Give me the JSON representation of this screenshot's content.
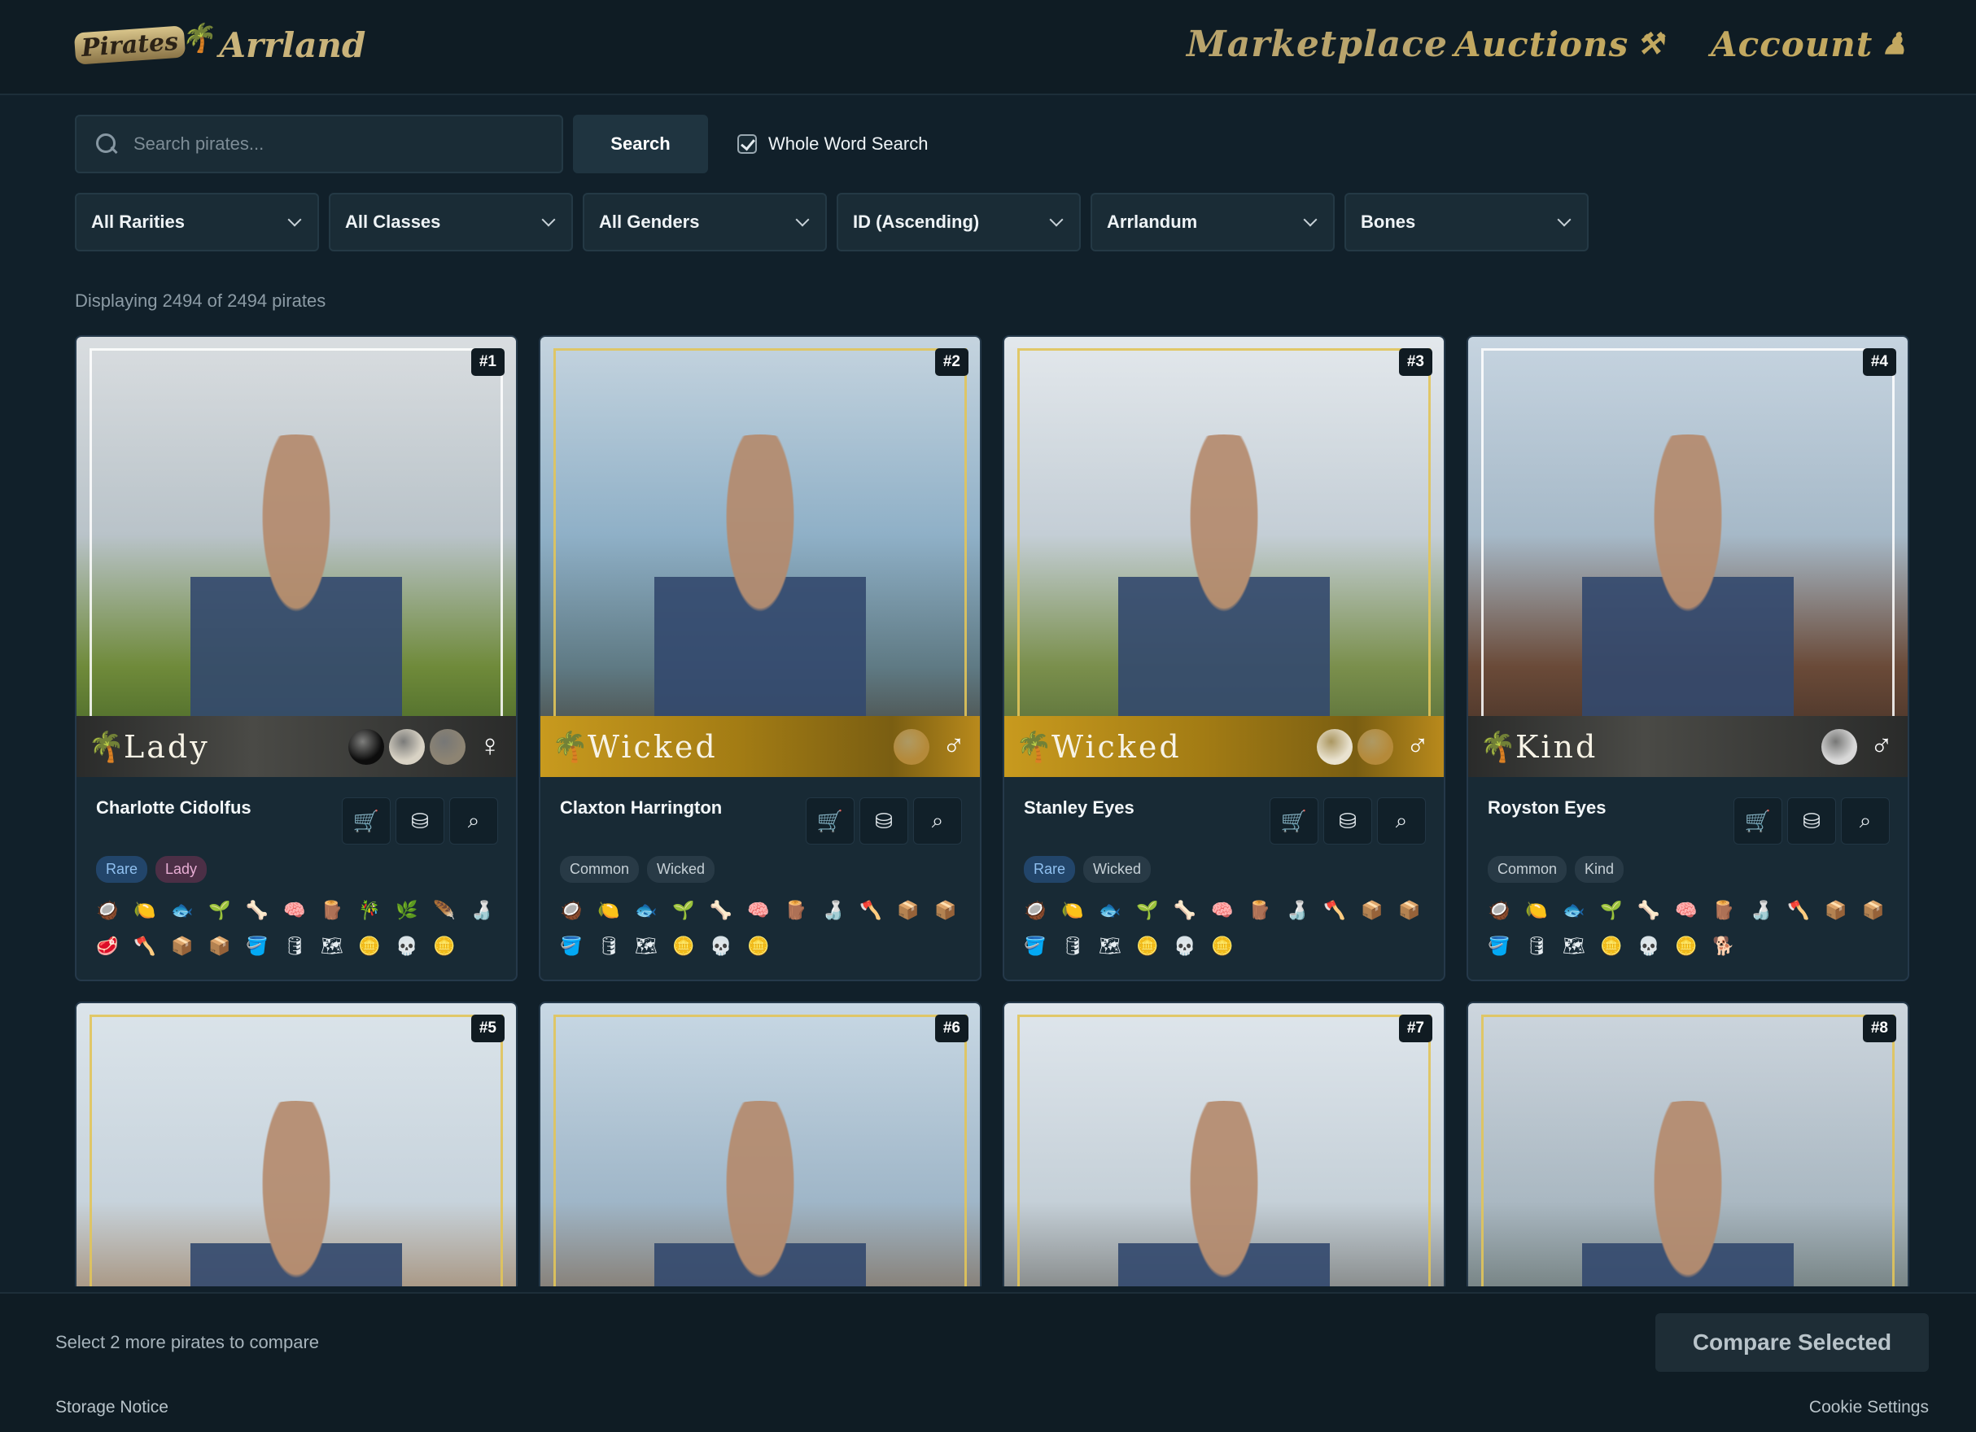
{
  "header": {
    "logo_top": "Pirates",
    "logo_main": "Arrland",
    "nav": [
      {
        "label": "Marketplace"
      },
      {
        "label": "Auctions"
      },
      {
        "label": "Account"
      }
    ]
  },
  "search": {
    "placeholder": "Search pirates...",
    "value": "",
    "button": "Search",
    "whole_word": {
      "label": "Whole Word Search",
      "checked": true
    }
  },
  "filters": [
    "All Rarities",
    "All Classes",
    "All Genders",
    "ID (Ascending)",
    "Arrlandum",
    "Bones"
  ],
  "results_text": "Displaying 2494 of 2494 pirates",
  "cards": [
    {
      "id": "#1",
      "name": "Charlotte Cidolfus",
      "class": "Lady",
      "gender": "♀",
      "strip": "dark",
      "tags": [
        {
          "t": "Rare",
          "k": "rare"
        },
        {
          "t": "Lady",
          "k": "lady"
        }
      ],
      "bg": [
        "#d9dde0",
        "#b9c3c9",
        "#6f8a3a",
        "#3a5a22"
      ],
      "medals": [
        "#0d0d0d",
        "#d8d2c4",
        "#8d8473"
      ],
      "icons": [
        "🥥",
        "🍋",
        "🐟",
        "🌱",
        "🦴",
        "🧠",
        "🪵",
        "🎋",
        "🌿",
        "🪶",
        "🍶",
        "🥩",
        "🪓",
        "📦",
        "📦",
        "🪣",
        "🛢",
        "🗺",
        "🪙",
        "💀",
        "🪙"
      ]
    },
    {
      "id": "#2",
      "name": "Claxton Harrington",
      "class": "Wicked",
      "gender": "♂",
      "strip": "gold",
      "tags": [
        {
          "t": "Common",
          "k": ""
        },
        {
          "t": "Wicked",
          "k": ""
        }
      ],
      "bg": [
        "#c5d4df",
        "#8fb0c7",
        "#5f7a84",
        "#403628"
      ],
      "medals": [
        "#b58a3a"
      ],
      "icons": [
        "🥥",
        "🍋",
        "🐟",
        "🌱",
        "🦴",
        "🧠",
        "🪵",
        "🍶",
        "🪓",
        "📦",
        "📦",
        "🪣",
        "🛢",
        "🗺",
        "🪙",
        "💀",
        "🪙"
      ]
    },
    {
      "id": "#3",
      "name": "Stanley Eyes",
      "class": "Wicked",
      "gender": "♂",
      "strip": "gold",
      "tags": [
        {
          "t": "Rare",
          "k": "rare"
        },
        {
          "t": "Wicked",
          "k": ""
        }
      ],
      "bg": [
        "#e3e8ec",
        "#c4ced6",
        "#7a8f4c",
        "#4a6030"
      ],
      "medals": [
        "#e9e2cf",
        "#b58a3a"
      ],
      "icons": [
        "🥥",
        "🍋",
        "🐟",
        "🌱",
        "🦴",
        "🧠",
        "🪵",
        "🍶",
        "🪓",
        "📦",
        "📦",
        "🪣",
        "🛢",
        "🗺",
        "🪙",
        "💀",
        "🪙"
      ]
    },
    {
      "id": "#4",
      "name": "Royston Eyes",
      "class": "Kind",
      "gender": "♂",
      "strip": "dark",
      "tags": [
        {
          "t": "Common",
          "k": ""
        },
        {
          "t": "Kind",
          "k": ""
        }
      ],
      "bg": [
        "#c6d4e0",
        "#a6b9c8",
        "#6a4a38",
        "#3a2a22"
      ],
      "medals": [
        "#d8d8d8"
      ],
      "icons": [
        "🥥",
        "🍋",
        "🐟",
        "🌱",
        "🦴",
        "🧠",
        "🪵",
        "🍶",
        "🪓",
        "📦",
        "📦",
        "🪣",
        "🛢",
        "🗺",
        "🪙",
        "💀",
        "🪙",
        "🐕"
      ]
    },
    {
      "id": "#5",
      "bg": [
        "#dbe4ea",
        "#c7d3dc",
        "#9a7a58",
        "#6b4a34"
      ]
    },
    {
      "id": "#6",
      "bg": [
        "#c8d8e4",
        "#9fb6c8",
        "#7c6650",
        "#4e3a2a"
      ]
    },
    {
      "id": "#7",
      "bg": [
        "#dfe6ec",
        "#c5d0d8",
        "#6a6a66",
        "#3b3a38"
      ]
    },
    {
      "id": "#8",
      "bg": [
        "#cdd6de",
        "#aab8c2",
        "#5e6a66",
        "#2f3436"
      ]
    }
  ],
  "compare": {
    "hint": "Select 2 more pirates to compare",
    "button": "Compare Selected"
  },
  "footer": {
    "storage": "Storage Notice",
    "cookie": "Cookie Settings"
  }
}
